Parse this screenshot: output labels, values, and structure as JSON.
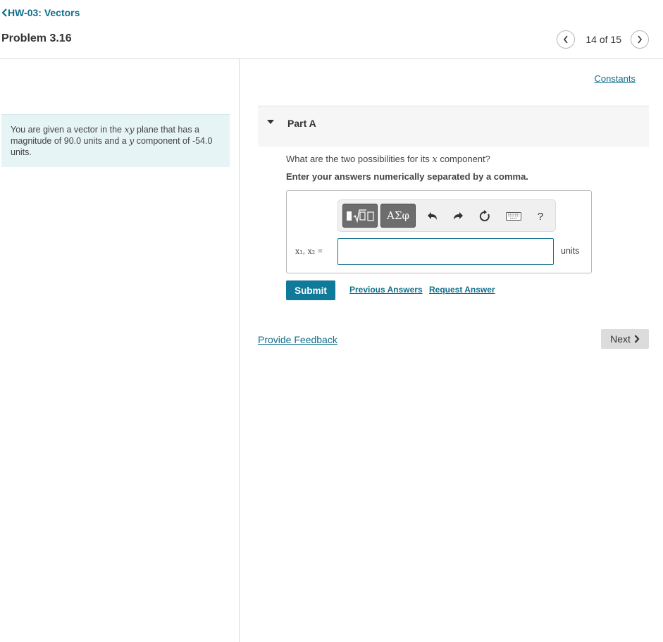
{
  "header": {
    "assignment_link": "HW-03: Vectors",
    "problem_title": "Problem 3.16",
    "page_count": "14 of 15"
  },
  "stem": {
    "text_1": "You are given a vector in the ",
    "var_xy": "xy",
    "text_2": " plane that has a magnitude of 90.0 units and a ",
    "var_y": "y",
    "text_3": " component of -54.0 units."
  },
  "main": {
    "constants_link": "Constants",
    "part_label": "Part A",
    "question_1": "What are the two possibilities for its ",
    "question_var": "x",
    "question_2": " component?",
    "instruction": "Enter your answers numerically separated by a comma.",
    "toolbar": {
      "greek_label": "ΑΣφ",
      "help_label": "?"
    },
    "input_label": "x₁, x₂",
    "input_eq": "=",
    "input_value": "",
    "units": "units",
    "submit_label": "Submit",
    "previous_answers_link": "Previous Answers",
    "request_answer_link": "Request Answer",
    "feedback_link": "Provide Feedback",
    "next_label": "Next"
  },
  "colors": {
    "accent": "#0f6f8c",
    "submit_bg": "#0f7a99",
    "stem_bg": "#e6f4f6"
  },
  "icons": [
    "chevron-left-icon",
    "chevron-right-icon",
    "collapse-triangle-icon",
    "template-icon",
    "undo-icon",
    "redo-icon",
    "reset-icon",
    "keyboard-icon",
    "help-icon"
  ]
}
